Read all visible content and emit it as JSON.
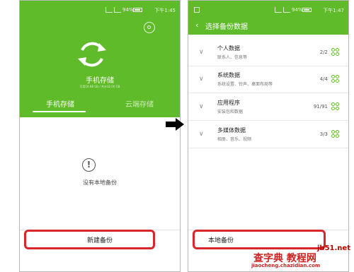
{
  "left_phone": {
    "status_bar": {
      "battery": "94%",
      "time": "下午1:45"
    },
    "title": "手机存储",
    "storage_info": "可用19.68 GB / 共计32.00 GB",
    "tabs": [
      "手机存储",
      "云端存储"
    ],
    "empty_text": "没有本地备份",
    "new_backup_button": "新建备份"
  },
  "right_phone": {
    "status_bar": {
      "battery": "94%",
      "time": "下午1:47"
    },
    "title": "选择备份数据",
    "items": [
      {
        "name": "个人数据",
        "desc": "联系人、信息等",
        "count": "2/2"
      },
      {
        "name": "系统数据",
        "desc": "系统设置、铃声、桌面布局等",
        "count": "4/4"
      },
      {
        "name": "应用程序",
        "desc": "安装包和数据",
        "count": "91/91"
      },
      {
        "name": "多媒体数据",
        "desc": "相册、音乐、视频",
        "count": "3/3"
      }
    ],
    "local_backup_button": "本地备份"
  },
  "watermark": {
    "site": "jb51.net",
    "text": "查字典 教程网",
    "url": "jiaocheng.chazidian.com"
  },
  "colors": {
    "accent": "#5fbb2a",
    "highlight": "#d9262b"
  }
}
